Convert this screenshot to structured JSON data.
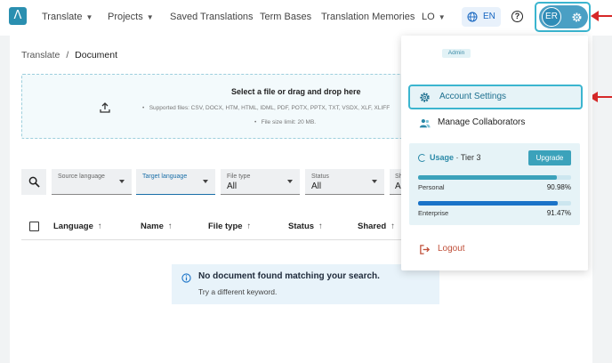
{
  "nav": {
    "items": [
      {
        "label": "Translate",
        "dropdown": true
      },
      {
        "label": "Projects",
        "dropdown": true
      },
      {
        "label": "Saved Translations",
        "dropdown": false
      },
      {
        "label": "Term Bases",
        "dropdown": false
      },
      {
        "label": "Translation Memories",
        "dropdown": false
      },
      {
        "label": "LO",
        "dropdown": true
      }
    ],
    "language": "EN",
    "user_initials": "ER"
  },
  "breadcrumb": {
    "root": "Translate",
    "separator": "/",
    "current": "Document"
  },
  "dropzone": {
    "title": "Select a file or drag and drop here",
    "supported": "Supported files: CSV, DOCX, HTM, HTML, IDML, PDF, POTX, PPTX, TXT, VSDX, XLF, XLIFF",
    "limit": "File size limit: 20 MB."
  },
  "filters": {
    "source": {
      "label": "Source language",
      "value": ""
    },
    "target": {
      "label": "Target language",
      "value": ""
    },
    "filetype": {
      "label": "File type",
      "value": "All"
    },
    "status": {
      "label": "Status",
      "value": "All"
    },
    "shared": {
      "label": "Sh",
      "value": "A"
    }
  },
  "table": {
    "columns": [
      "Language",
      "Name",
      "File type",
      "Status",
      "Shared"
    ],
    "sort_glyph": "↑"
  },
  "empty_state": {
    "title": "No document found matching your search.",
    "subtitle": "Try a different keyword."
  },
  "menu": {
    "role": "Admin",
    "account_settings": "Account Settings",
    "manage_collaborators": "Manage Collaborators",
    "usage": {
      "label": "Usage",
      "tier": "· Tier 3",
      "upgrade": "Upgrade",
      "personal": {
        "label": "Personal",
        "percent": "90.98%",
        "fraction": 0.9098
      },
      "enterprise": {
        "label": "Enterprise",
        "percent": "91.47%",
        "fraction": 0.9147
      }
    },
    "logout": "Logout"
  },
  "colors": {
    "accent": "#3bb5cf",
    "brand": "#2a8fb0",
    "annotation_arrow": "#d62828",
    "personal_bar": "#3ba2bb",
    "enterprise_bar": "#1a73c8",
    "logout": "#c0503a"
  }
}
